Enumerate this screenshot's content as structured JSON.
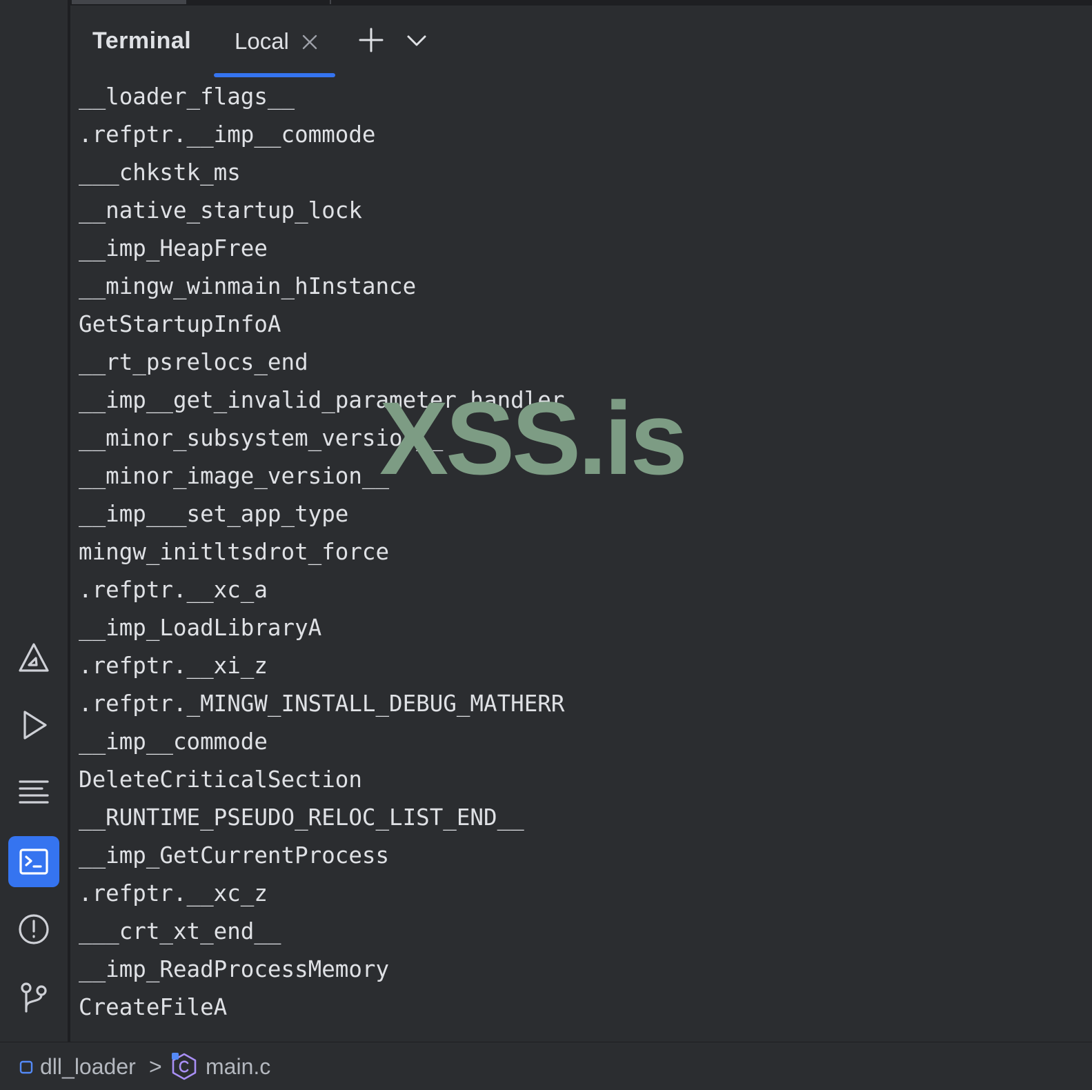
{
  "window": {
    "panel_title": "Terminal",
    "tab": {
      "label": "Local",
      "close_icon": "close-icon"
    },
    "actions": {
      "new_tab_icon": "plus-icon",
      "more_tabs_icon": "chevron-down-icon"
    }
  },
  "sidebar": {
    "items": [
      {
        "icon": "build-icon",
        "active": false
      },
      {
        "icon": "run-icon",
        "active": false
      },
      {
        "icon": "structure-icon",
        "active": false
      },
      {
        "icon": "terminal-icon",
        "active": true
      },
      {
        "icon": "problems-icon",
        "active": false
      },
      {
        "icon": "git-branch-icon",
        "active": false
      }
    ]
  },
  "terminal": {
    "lines": [
      "__loader_flags__",
      ".refptr.__imp__commode",
      "___chkstk_ms",
      "__native_startup_lock",
      "__imp_HeapFree",
      "__mingw_winmain_hInstance",
      "GetStartupInfoA",
      "__rt_psrelocs_end",
      "__imp__get_invalid_parameter_handler",
      "__minor_subsystem_version__",
      "__minor_image_version__",
      "__imp___set_app_type",
      "mingw_initltsdrot_force",
      ".refptr.__xc_a",
      "__imp_LoadLibraryA",
      ".refptr.__xi_z",
      ".refptr._MINGW_INSTALL_DEBUG_MATHERR",
      "__imp__commode",
      "DeleteCriticalSection",
      "__RUNTIME_PSEUDO_RELOC_LIST_END__",
      "__imp_GetCurrentProcess",
      ".refptr.__xc_z",
      "___crt_xt_end__",
      "__imp_ReadProcessMemory",
      "CreateFileA"
    ]
  },
  "watermark": {
    "text": "XSS.is",
    "color": "#7d9c84"
  },
  "statusbar": {
    "project": "dll_loader",
    "separator": ">",
    "file": "main.c"
  },
  "colors": {
    "accent": "#3574f0",
    "panel_bg": "#2b2d30",
    "text": "#dfe1e5"
  }
}
